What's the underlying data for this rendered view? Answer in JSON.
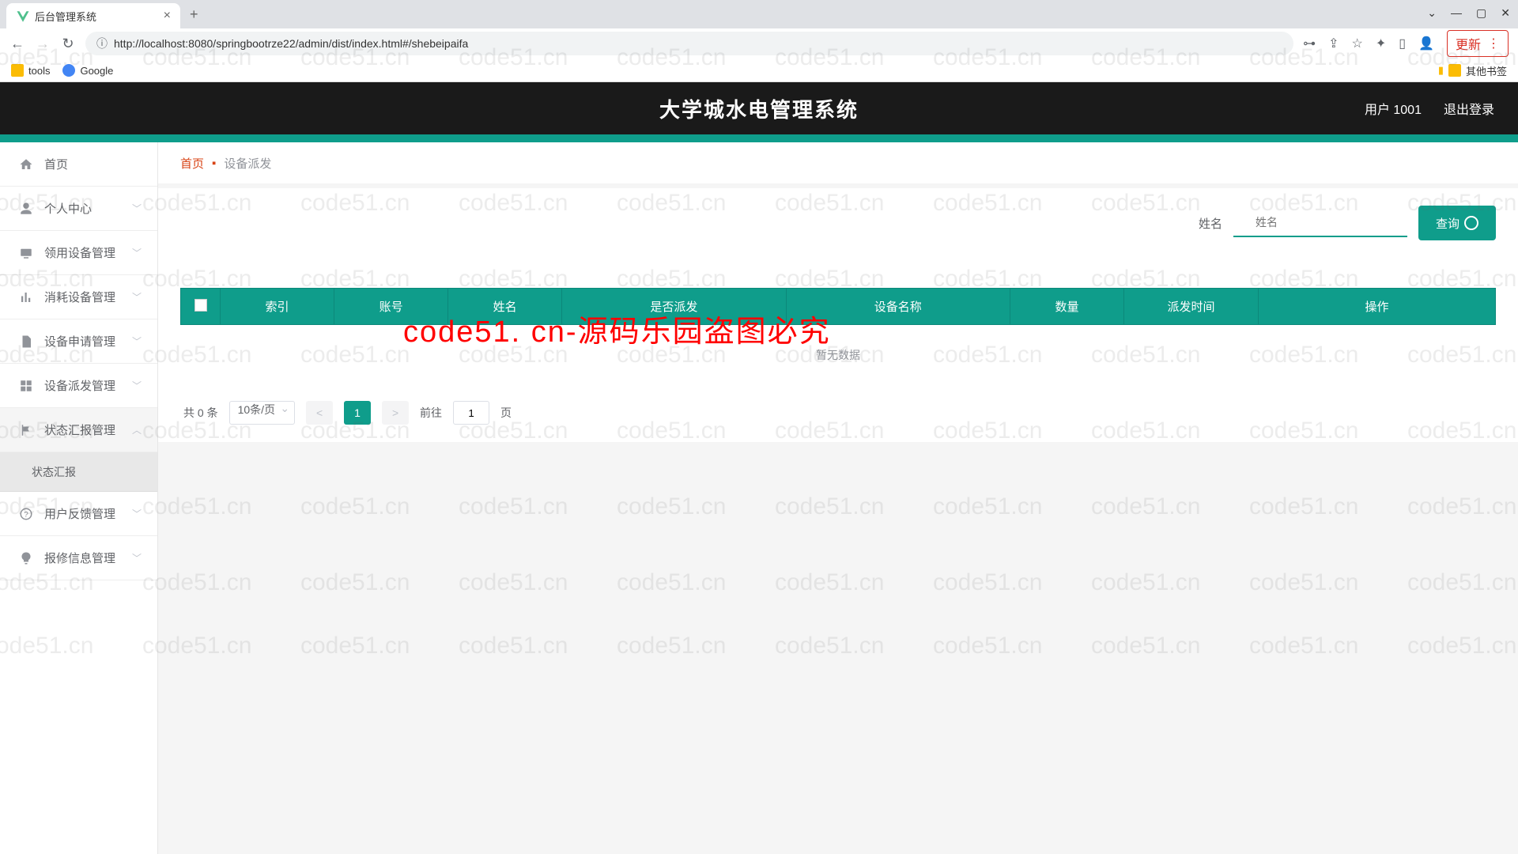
{
  "browser": {
    "tab_title": "后台管理系统",
    "url": "http://localhost:8080/springbootrze22/admin/dist/index.html#/shebeipaifa",
    "update_btn": "更新",
    "bookmarks": {
      "tools": "tools",
      "google": "Google",
      "other": "其他书签"
    }
  },
  "header": {
    "title": "大学城水电管理系统",
    "user": "用户 1001",
    "logout": "退出登录"
  },
  "sidebar": {
    "items": [
      {
        "label": "首页",
        "icon": "home"
      },
      {
        "label": "个人中心",
        "icon": "user",
        "chev": true
      },
      {
        "label": "领用设备管理",
        "icon": "device",
        "chev": true
      },
      {
        "label": "消耗设备管理",
        "icon": "chart",
        "chev": true
      },
      {
        "label": "设备申请管理",
        "icon": "doc",
        "chev": true
      },
      {
        "label": "设备派发管理",
        "icon": "grid",
        "chev": true
      },
      {
        "label": "状态汇报管理",
        "icon": "flag",
        "chev": true,
        "expanded": true,
        "sub": "状态汇报"
      },
      {
        "label": "用户反馈管理",
        "icon": "help",
        "chev": true
      },
      {
        "label": "报修信息管理",
        "icon": "bulb",
        "chev": true
      }
    ]
  },
  "breadcrumb": {
    "home": "首页",
    "current": "设备派发"
  },
  "search": {
    "label": "姓名",
    "placeholder": "姓名",
    "btn": "查询"
  },
  "table": {
    "headers": [
      "索引",
      "账号",
      "姓名",
      "是否派发",
      "设备名称",
      "数量",
      "派发时间",
      "操作"
    ],
    "empty": "暂无数据"
  },
  "pager": {
    "total": "共 0 条",
    "perpage": "10条/页",
    "page": "1",
    "goto_pre": "前往",
    "goto_val": "1",
    "goto_suf": "页"
  },
  "watermark_text": "code51.cn",
  "watermark_red": "code51. cn-源码乐园盗图必究"
}
